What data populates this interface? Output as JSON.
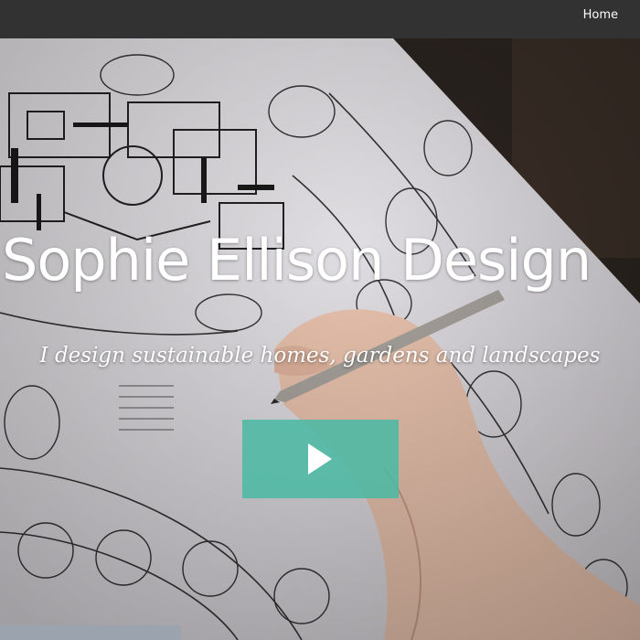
{
  "nav": {
    "home_label": "Home"
  },
  "hero": {
    "title": "Sophie Ellison Design",
    "subtitle": "I design sustainable homes, gardens and landscapes",
    "play_icon": "play-icon",
    "accent_color": "#4cbaa4"
  }
}
